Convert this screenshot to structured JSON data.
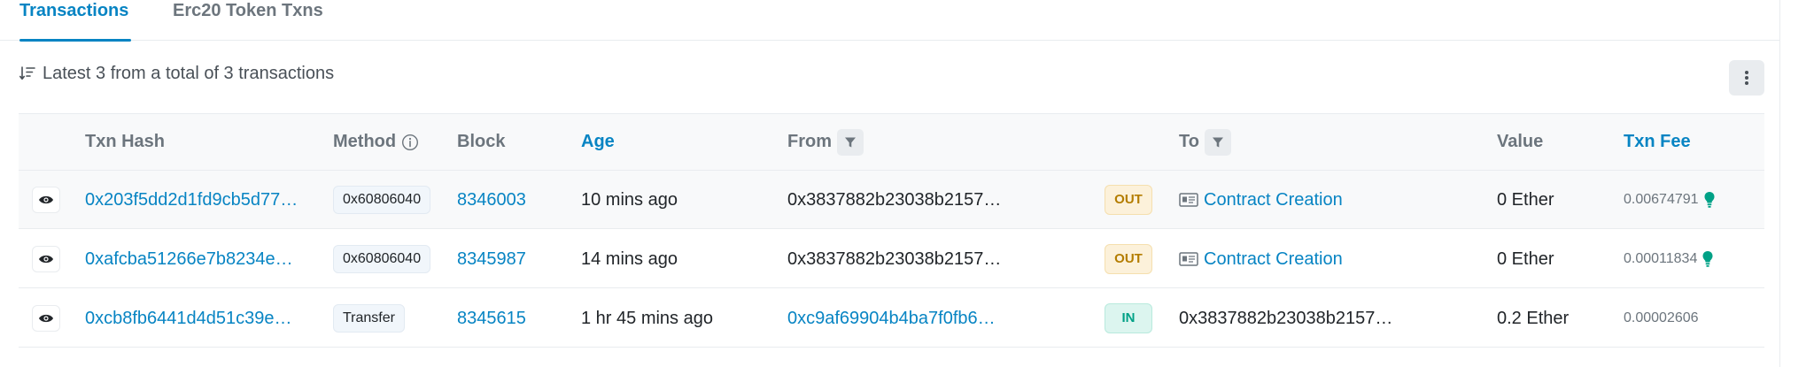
{
  "tabs": [
    {
      "label": "Transactions",
      "active": true
    },
    {
      "label": "Erc20 Token Txns",
      "active": false
    }
  ],
  "summary": {
    "text": "Latest 3 from a total of 3 transactions",
    "sort_icon": "sort-desc-icon",
    "more_icon": "vertical-dots-icon"
  },
  "table": {
    "headers": {
      "txn_hash": "Txn Hash",
      "method": "Method",
      "block": "Block",
      "age": "Age",
      "from": "From",
      "to": "To",
      "value": "Value",
      "txn_fee": "Txn Fee"
    },
    "rows": [
      {
        "hash": "0x203f5dd2d1fd9cb5d77…",
        "method": "0x60806040",
        "block": "8346003",
        "age": "10 mins ago",
        "from": "0x3837882b23038b2157…",
        "direction": "OUT",
        "to": "Contract Creation",
        "value": "0 Ether",
        "fee": "0.00674791"
      },
      {
        "hash": "0xafcba51266e7b8234e…",
        "method": "0x60806040",
        "block": "8345987",
        "age": "14 mins ago",
        "from": "0x3837882b23038b2157…",
        "direction": "OUT",
        "to": "Contract Creation",
        "value": "0 Ether",
        "fee": "0.00011834"
      },
      {
        "hash": "0xcb8fb6441d4d51c39e…",
        "method": "Transfer",
        "block": "8345615",
        "age": "1 hr 45 mins ago",
        "from": "0xc9af69904b4ba7f0fb6…",
        "direction": "IN",
        "to": "0x3837882b23038b2157…",
        "value": "0.2 Ether",
        "fee": "0.00002606"
      }
    ]
  },
  "colors": {
    "link": "#0784c3",
    "out_badge": "#b47d00",
    "in_badge": "#00a186",
    "bulb": "#00a186"
  }
}
